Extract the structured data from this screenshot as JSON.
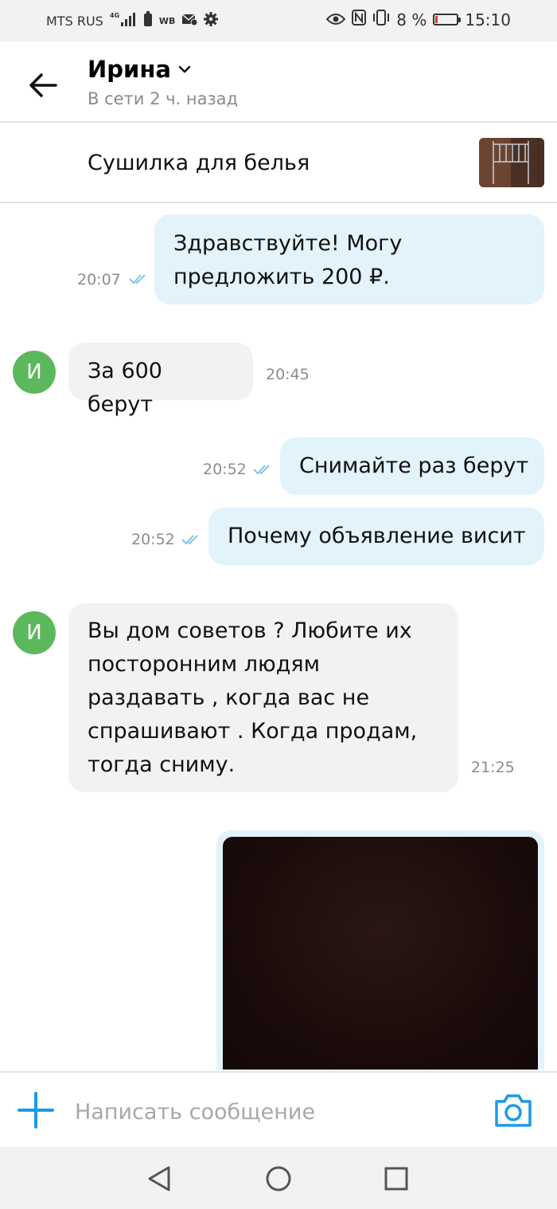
{
  "status_bar": {
    "carrier": "MTS RUS",
    "network_badge": "4G",
    "app_badge": "WB",
    "battery_percent": "8 %",
    "battery_level": 0.08,
    "time": "15:10",
    "icons": [
      "signal-icon",
      "battery-saver-icon",
      "mail-icon",
      "gear-icon",
      "eye-icon",
      "nfc-icon",
      "vibrate-icon",
      "battery-icon"
    ]
  },
  "header": {
    "contact_name": "Ирина",
    "status": "В сети 2 ч. назад"
  },
  "item": {
    "title": "Сушилка для белья"
  },
  "messages": [
    {
      "direction": "out",
      "lines": [
        "Здравствуйте! Могу",
        "предложить 200 ₽."
      ],
      "time": "20:07",
      "read": true
    },
    {
      "direction": "in",
      "avatar": "И",
      "lines": [
        "За 600 берут"
      ],
      "time": "20:45"
    },
    {
      "direction": "out",
      "lines": [
        "Снимайте раз берут"
      ],
      "time": "20:52",
      "read": true
    },
    {
      "direction": "out",
      "lines": [
        "Почему объявление висит"
      ],
      "time": "20:52",
      "read": true
    },
    {
      "direction": "in",
      "avatar": "И",
      "lines": [
        "Вы дом советов ? Любите их",
        "посторонним людям",
        "раздавать , когда вас не",
        "спрашивают . Когда продам,",
        "тогда сниму."
      ],
      "time": "21:25"
    },
    {
      "direction": "out",
      "type": "photo"
    }
  ],
  "composer": {
    "placeholder": "Написать сообщение"
  },
  "colors": {
    "accent": "#1a9be6",
    "outgoing_bubble": "#e2f3fc",
    "incoming_bubble": "#f2f2f2",
    "avatar": "#5cb85c",
    "read_ticks": "#7fc4e8"
  }
}
